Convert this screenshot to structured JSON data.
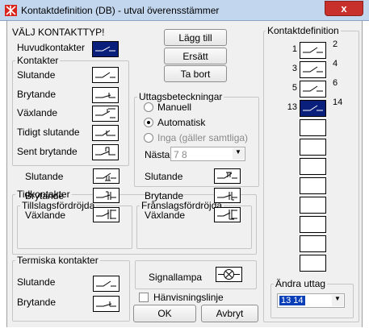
{
  "window": {
    "title": "Kontaktdefinition (DB) - utval överensstämmer",
    "close_glyph": "x"
  },
  "heading": "VÄLJ KONTAKTTYP!",
  "main_contact": {
    "label": "Huvudkontakter"
  },
  "buttons": {
    "add": "Lägg till",
    "replace": "Ersätt",
    "remove": "Ta bort",
    "ok": "OK",
    "cancel": "Avbryt"
  },
  "contacts": {
    "title": "Kontakter",
    "items": [
      {
        "label": "Slutande",
        "symbol": "make-contact"
      },
      {
        "label": "Brytande",
        "symbol": "break-contact"
      },
      {
        "label": "Växlande",
        "symbol": "changeover-contact"
      },
      {
        "label": "Tidigt slutande",
        "symbol": "early-make-contact"
      },
      {
        "label": "Sent brytande",
        "symbol": "late-break-contact"
      }
    ]
  },
  "terminals": {
    "title": "Uttagsbeteckningar",
    "options": [
      {
        "label": "Manuell",
        "selected": false,
        "enabled": true
      },
      {
        "label": "Automatisk",
        "selected": true,
        "enabled": true
      },
      {
        "label": "Inga (gäller samtliga)",
        "selected": false,
        "enabled": false
      }
    ],
    "next_label": "Nästa",
    "next_value": "7 8"
  },
  "timer": {
    "title": "Tidkontakter",
    "on_delay": {
      "title": "Tillslagsfördröjda",
      "items": [
        {
          "label": "Slutande"
        },
        {
          "label": "Brytande"
        },
        {
          "label": "Växlande"
        }
      ]
    },
    "off_delay": {
      "title": "Frånslagsfördröjda",
      "items": [
        {
          "label": "Slutande"
        },
        {
          "label": "Brytande"
        },
        {
          "label": "Växlande"
        }
      ]
    }
  },
  "thermal": {
    "title": "Termiska kontakter",
    "items": [
      {
        "label": "Slutande"
      },
      {
        "label": "Brytande"
      }
    ]
  },
  "signal_lamp": {
    "label": "Signallampa"
  },
  "reference_line": {
    "label": "Hänvisningslinje",
    "checked": false
  },
  "definition": {
    "title": "Kontaktdefinition",
    "slots": [
      {
        "left": "1",
        "right": "2",
        "symbol": "make-contact",
        "selected": false
      },
      {
        "left": "3",
        "right": "4",
        "symbol": "make-contact",
        "selected": false
      },
      {
        "left": "5",
        "right": "6",
        "symbol": "make-contact",
        "selected": false
      },
      {
        "left": "13",
        "right": "14",
        "symbol": "make-contact",
        "selected": true
      },
      {
        "left": "",
        "right": "",
        "symbol": "",
        "selected": false
      },
      {
        "left": "",
        "right": "",
        "symbol": "",
        "selected": false
      },
      {
        "left": "",
        "right": "",
        "symbol": "",
        "selected": false
      },
      {
        "left": "",
        "right": "",
        "symbol": "",
        "selected": false
      },
      {
        "left": "",
        "right": "",
        "symbol": "",
        "selected": false
      },
      {
        "left": "",
        "right": "",
        "symbol": "",
        "selected": false
      },
      {
        "left": "",
        "right": "",
        "symbol": "",
        "selected": false
      },
      {
        "left": "",
        "right": "",
        "symbol": "",
        "selected": false
      }
    ],
    "change_terminal_title": "Ändra uttag",
    "change_terminal_value": "13 14"
  },
  "colors": {
    "selected_symbol_bg": "#0a1f7c",
    "title_bar": "#c2d6ee",
    "close_button": "#c8312b"
  }
}
